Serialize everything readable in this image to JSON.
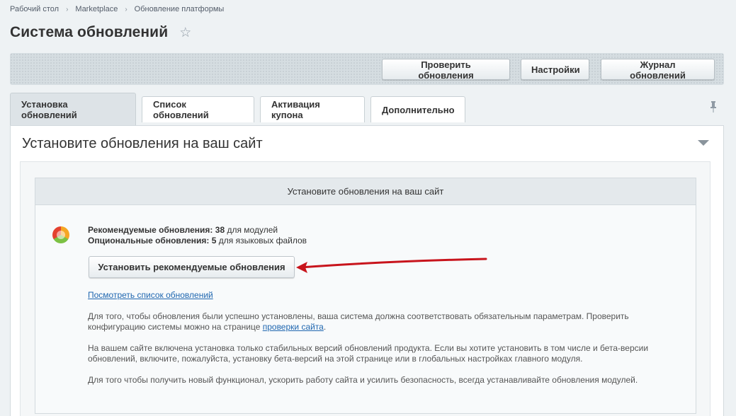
{
  "breadcrumb": [
    "Рабочий стол",
    "Marketplace",
    "Обновление платформы"
  ],
  "page": {
    "title": "Система обновлений"
  },
  "toolbar": {
    "check_label": "Проверить обновления",
    "settings_label": "Настройки",
    "journal_label": "Журнал обновлений"
  },
  "tabs": [
    {
      "label": "Установка обновлений",
      "active": true
    },
    {
      "label": "Список обновлений",
      "active": false
    },
    {
      "label": "Активация купона",
      "active": false
    },
    {
      "label": "Дополнительно",
      "active": false
    }
  ],
  "panel": {
    "heading": "Установите обновления на ваш сайт",
    "box_heading": "Установите обновления на ваш сайт",
    "recommended_label": "Рекомендуемые обновления:",
    "recommended_count": "38",
    "recommended_suffix": " для модулей",
    "optional_label": "Опциональные обновления:",
    "optional_count": "5",
    "optional_suffix": " для языковых файлов",
    "install_button": "Установить рекомендуемые обновления",
    "view_list_link": "Посмотреть список обновлений",
    "para1_text": "Для того, чтобы обновления были успешно установлены, ваша система должна соответствовать обязательным параметрам. Проверить конфигурацию системы можно на странице ",
    "para1_link": "проверки сайта",
    "para1_end": ".",
    "para2": "На вашем сайте включена установка только стабильных версий обновлений продукта. Если вы хотите установить в том числе и бета-версии обновлений, включите, пожалуйста, установку бета-версий на этой странице или в глобальных настройках главного модуля.",
    "para3": "Для того чтобы получить новый функционал, ускорить работу сайта и усилить безопасность, всегда устанавливайте обновления модулей."
  },
  "colors": {
    "background": "#eef2f4",
    "link": "#2067b0",
    "arrow": "#c8141c"
  }
}
